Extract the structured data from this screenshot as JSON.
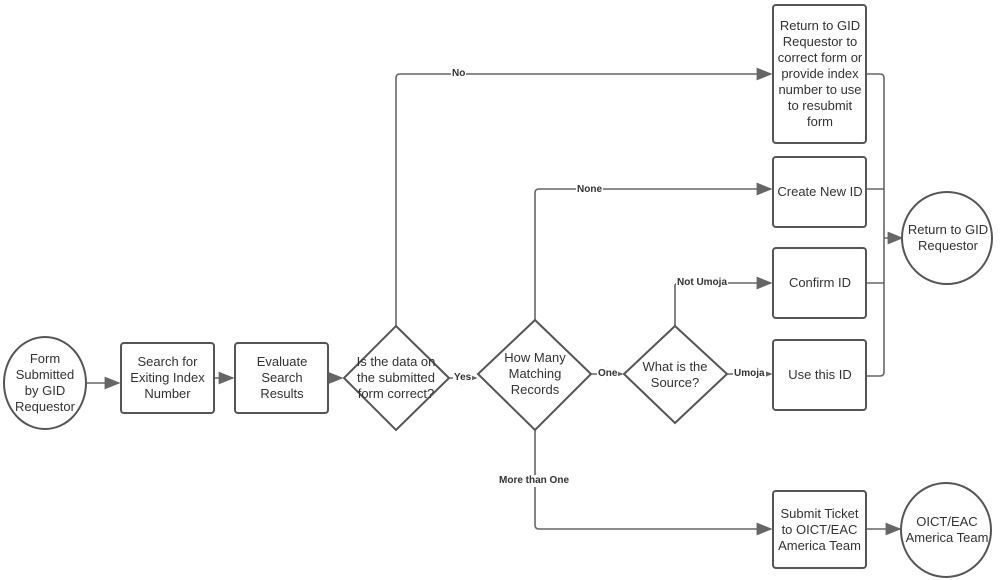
{
  "diagram": {
    "type": "flowchart",
    "nodes": {
      "form_submitted": "Form Submitted by GID Requestor",
      "search_index": "Search for Exiting Index Number",
      "evaluate_results": "Evaluate Search Results",
      "data_correct": "Is the data on the submitted form correct?",
      "how_many": "How Many Matching Records",
      "what_source": "What is the Source?",
      "return_correct": "Return to GID Requestor to correct form or provide index number to use to resubmit form",
      "create_new_id": "Create New ID",
      "confirm_id": "Confirm ID",
      "use_this_id": "Use this ID",
      "return_gid": "Return to GID Requestor",
      "submit_ticket": "Submit Ticket to OICT/EAC America Team",
      "oict_team": "OICT/EAC America Team"
    },
    "edge_labels": {
      "no": "No",
      "yes": "Yes",
      "none": "None",
      "one": "One",
      "more_than_one": "More than One",
      "not_umoja": "Not Umoja",
      "umoja": "Umoja"
    },
    "colors": {
      "stroke": "#555555",
      "text": "#333333",
      "background": "#ffffff"
    }
  }
}
